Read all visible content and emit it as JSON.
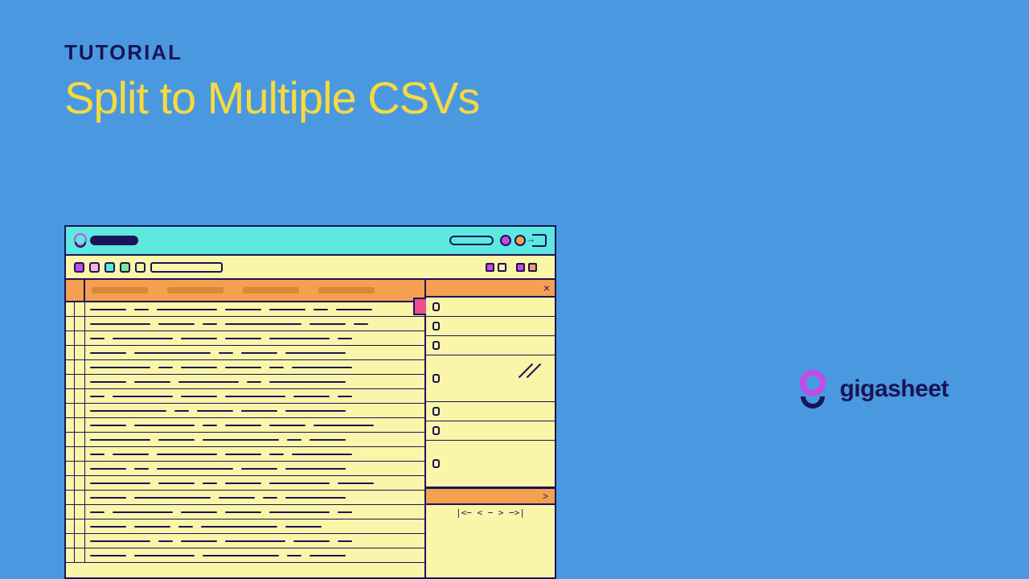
{
  "heading": {
    "eyebrow": "TUTORIAL",
    "title": "Split to Multiple CSVs"
  },
  "brand": {
    "name": "gigasheet"
  },
  "sidepanel": {
    "close": "×",
    "next": ">",
    "pager": "|<−  <  −  >  −>|"
  }
}
